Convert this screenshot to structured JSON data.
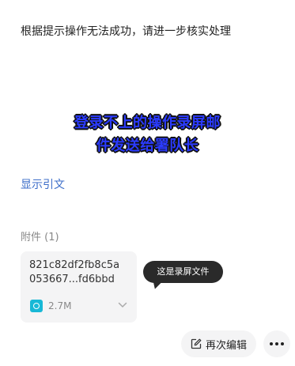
{
  "message": {
    "instruction_text": "根据提示操作无法成功，请进一步核实处理",
    "overlay_line1": "登录不上的操作录屏邮",
    "overlay_line2": "件发送给署队长",
    "quote_link": "显示引文"
  },
  "attachments": {
    "header": "附件 (1)",
    "file": {
      "name_line1": "821c82df2fb8c5a",
      "name_line2": "053667...fd6bbd",
      "size": "2.7M",
      "icon": "video-file-icon"
    },
    "tooltip": "这是录屏文件"
  },
  "actions": {
    "edit_label": "再次编辑",
    "edit_icon": "edit-icon",
    "more_icon": "more-icon"
  },
  "colors": {
    "link": "#3d6ec9",
    "overlay_text": "#2b3bff",
    "file_icon": "#18b8d6",
    "tooltip_bg": "#2a2a2a"
  }
}
